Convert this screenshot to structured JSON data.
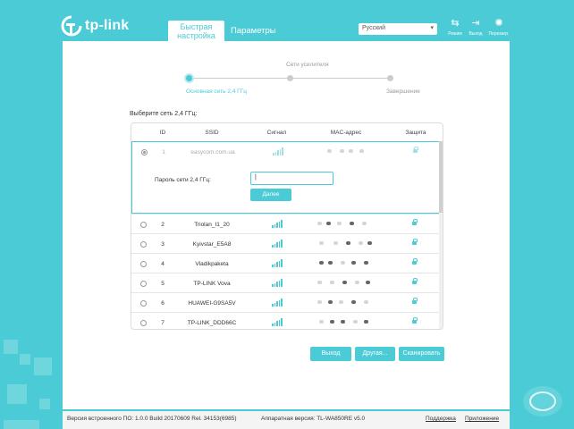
{
  "brand": {
    "logo_text": "tp-link"
  },
  "tabs": [
    {
      "label_line1": "Быстрая",
      "label_line2": "настройка",
      "active": true
    },
    {
      "label": "Параметры",
      "active": false
    }
  ],
  "language": {
    "selected": "Русский"
  },
  "header_icons": [
    {
      "icon": "mode-icon",
      "label": "Режим"
    },
    {
      "icon": "logout-icon",
      "label": "Выход"
    },
    {
      "icon": "reboot-icon",
      "label": "Перезагр."
    }
  ],
  "steps": {
    "top_label": "Сети усилителя",
    "items": [
      {
        "label": "Основная сеть 2,4 ГГц",
        "active": true
      },
      {
        "label": "",
        "active": false
      },
      {
        "label": "Завершение",
        "active": false
      }
    ]
  },
  "table": {
    "caption": "Выберите сеть 2,4 ГГц:",
    "headers": [
      "ID",
      "SSID",
      "Сигнал",
      "MAC-адрес",
      "Защита"
    ],
    "selected_row": {
      "id": "1",
      "ssid": "easycom.com.ua"
    },
    "password_label": "Пароль сети 2,4 ГГц:",
    "password_value": "|",
    "next_button": "Далее",
    "rows": [
      {
        "id": "2",
        "ssid": "Triolan_I1_20"
      },
      {
        "id": "3",
        "ssid": "Kyivstar_E5A8"
      },
      {
        "id": "4",
        "ssid": "Vladikpaketa"
      },
      {
        "id": "5",
        "ssid": "TP-LINK Vova"
      },
      {
        "id": "6",
        "ssid": "HUAWEI-G9SA5V"
      },
      {
        "id": "7",
        "ssid": "TP-LINK_DDD66C"
      }
    ]
  },
  "buttons": {
    "exit": "Выход",
    "other": "Другая...",
    "scan": "Сканировать"
  },
  "footer": {
    "firmware": "Версия встроенного ПО: 1.0.0 Build 20170609 Rel. 34153(6985)",
    "hardware": "Аппаратная версия: TL-WA850RE v5.0",
    "support": "Поддержка",
    "app": "Приложение"
  },
  "colors": {
    "accent": "#4acbd6",
    "background": "#4acbd6",
    "panel": "#ffffff"
  }
}
